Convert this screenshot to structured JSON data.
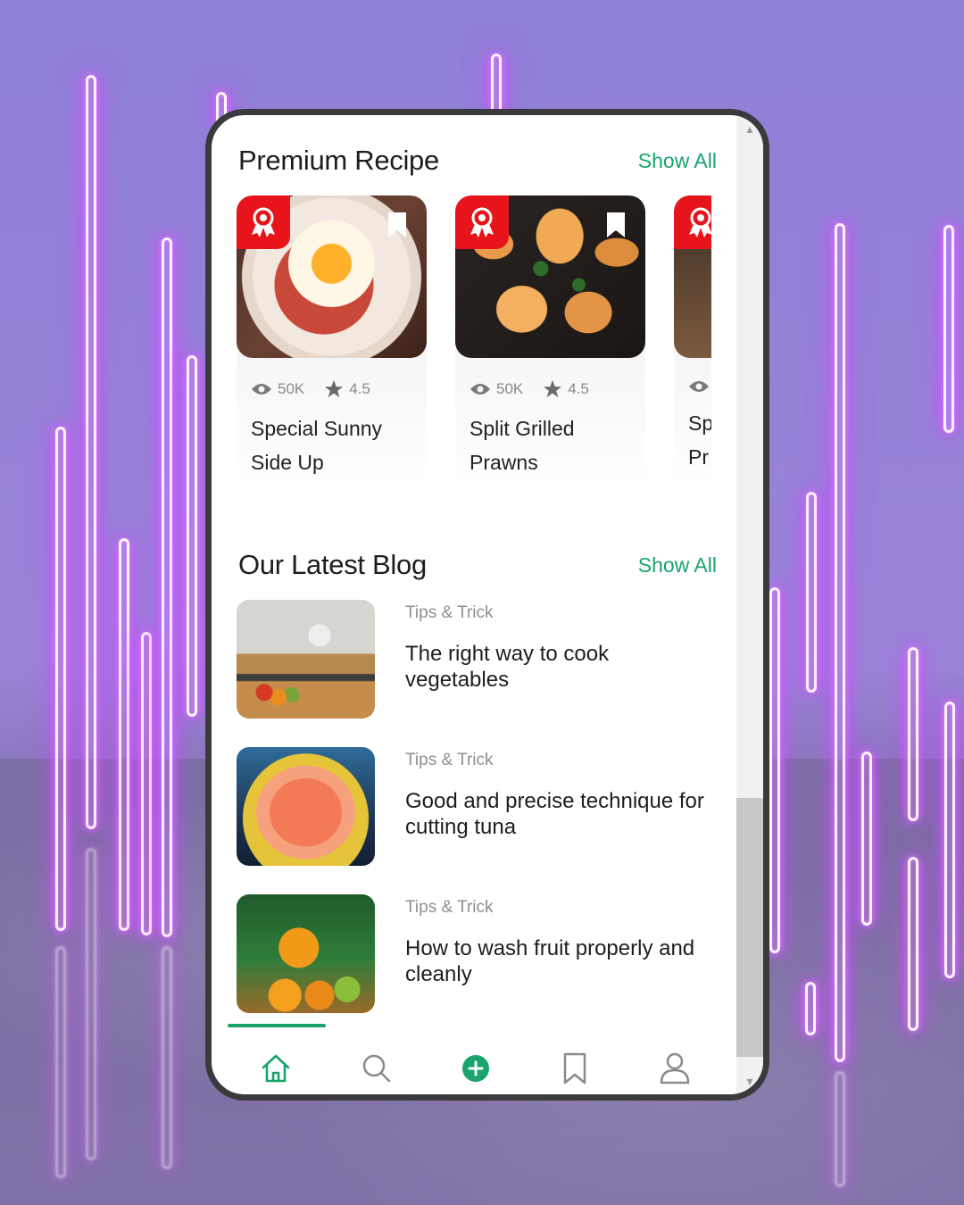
{
  "colors": {
    "accent": "#1aa46b",
    "badge_red": "#e8141b",
    "text_dark": "#1d1d1d",
    "text_muted": "#8a8a8a"
  },
  "premium": {
    "title": "Premium Recipe",
    "show_all": "Show All",
    "cards": [
      {
        "views": "50K",
        "rating": "4.5",
        "title_line1": "Special Sunny",
        "title_line2": "Side Up"
      },
      {
        "views": "50K",
        "rating": "4.5",
        "title_line1": "Split Grilled",
        "title_line2": "Prawns"
      },
      {
        "views": "",
        "rating": "",
        "title_line1": "Sp",
        "title_line2": "Pr"
      }
    ]
  },
  "blog": {
    "title": "Our Latest Blog",
    "show_all": "Show All",
    "items": [
      {
        "tag": "Tips & Trick",
        "title": "The right way to cook vegetables"
      },
      {
        "tag": "Tips & Trick",
        "title": "Good and precise technique for cutting tuna"
      },
      {
        "tag": "Tips & Trick",
        "title": "How to wash fruit properly and cleanly"
      }
    ]
  },
  "nav": {
    "items": [
      "home-icon",
      "search-icon",
      "add-icon",
      "bookmark-icon",
      "profile-icon"
    ],
    "active": "home-icon"
  }
}
